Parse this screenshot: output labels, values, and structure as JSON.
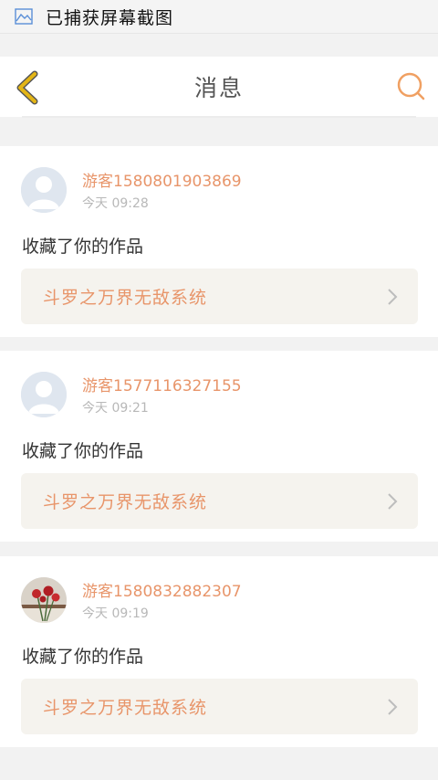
{
  "status_bar": {
    "icon": "screenshot-icon",
    "text": "已捕获屏幕截图"
  },
  "navbar": {
    "title": "消息",
    "back_icon": "chevron-left-icon",
    "search_icon": "search-icon"
  },
  "messages": [
    {
      "username": "游客1580801903869",
      "time": "今天 09:28",
      "action": "收藏了你的作品",
      "work_title": "斗罗之万界无敌系统",
      "avatar": "default-avatar"
    },
    {
      "username": "游客1577116327155",
      "time": "今天 09:21",
      "action": "收藏了你的作品",
      "work_title": "斗罗之万界无敌系统",
      "avatar": "default-avatar"
    },
    {
      "username": "游客1580832882307",
      "time": "今天 09:19",
      "action": "收藏了你的作品",
      "work_title": "斗罗之万界无敌系统",
      "avatar": "rose-photo-avatar"
    }
  ],
  "colors": {
    "accent": "#e8956a",
    "back_icon": "#e3b516",
    "work_bg": "#f5f3ee"
  }
}
